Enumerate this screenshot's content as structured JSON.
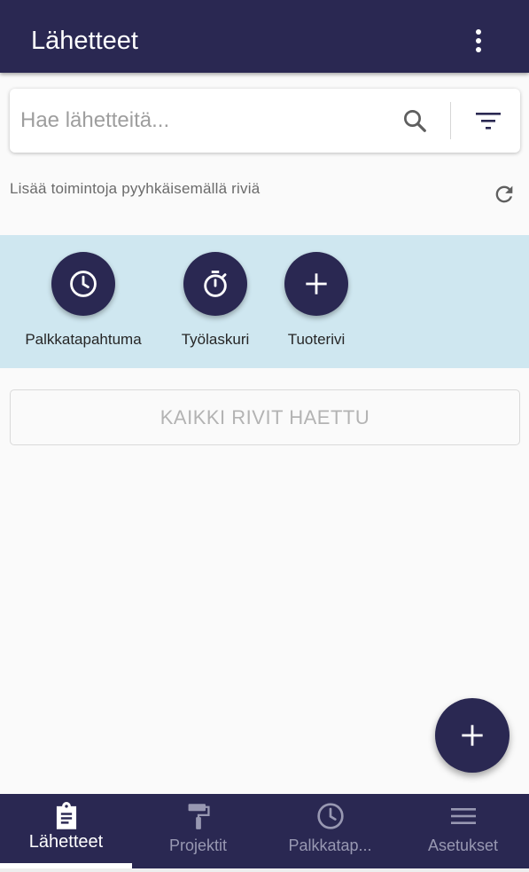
{
  "appbar": {
    "title": "Lähetteet",
    "more_icon": "more-vert-icon"
  },
  "search": {
    "placeholder": "Hae lähetteitä...",
    "value": "",
    "search_icon": "search-icon",
    "filter_icon": "filter-icon"
  },
  "hint": {
    "text": "Lisää toimintoja pyyhkäisemällä riviä",
    "refresh_icon": "refresh-icon"
  },
  "actions": [
    {
      "label": "Palkkatapahtuma",
      "icon": "clock-icon"
    },
    {
      "label": "Työlaskuri",
      "icon": "stopwatch-icon"
    },
    {
      "label": "Tuoterivi",
      "icon": "plus-icon"
    }
  ],
  "load_status": {
    "label": "KAIKKI RIVIT HAETTU"
  },
  "fab": {
    "icon": "plus-icon"
  },
  "bottom_nav": {
    "items": [
      {
        "label": "Lähetteet",
        "icon": "clipboard-icon",
        "active": true
      },
      {
        "label": "Projektit",
        "icon": "paint-roller-icon",
        "active": false
      },
      {
        "label": "Palkkatap...",
        "icon": "clock-icon",
        "active": false
      },
      {
        "label": "Asetukset",
        "icon": "menu-icon",
        "active": false
      }
    ]
  },
  "colors": {
    "primary": "#2a2852",
    "actions_background": "#cfe7f0",
    "page_background": "#fafafa"
  }
}
